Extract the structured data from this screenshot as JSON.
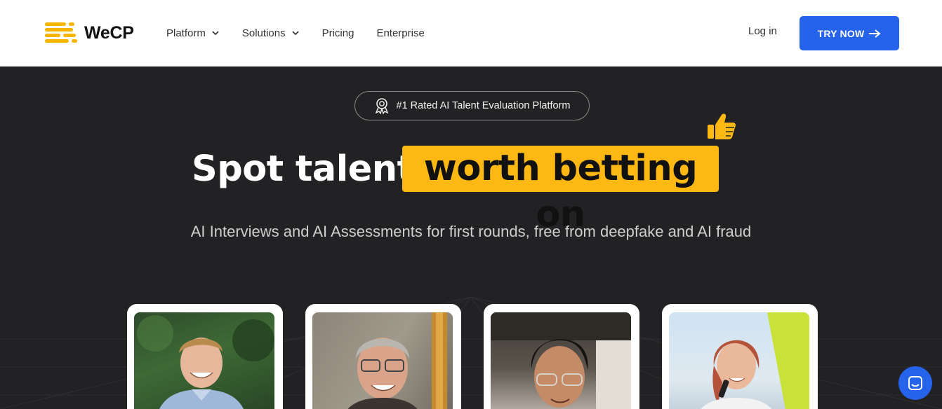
{
  "brand": {
    "name": "WeCP",
    "accent": "#fdb813",
    "primary": "#2563eb"
  },
  "nav": {
    "items": [
      {
        "label": "Platform",
        "has_dropdown": true
      },
      {
        "label": "Solutions",
        "has_dropdown": true
      },
      {
        "label": "Pricing",
        "has_dropdown": false
      },
      {
        "label": "Enterprise",
        "has_dropdown": false
      }
    ],
    "login_label": "Log in",
    "cta_label": "TRY NOW"
  },
  "hero": {
    "badge_text": "#1 Rated AI Talent Evaluation Platform",
    "headline_plain": "Spot talent",
    "headline_highlight": "worth betting on",
    "subtitle": "AI Interviews and AI Assessments for first rounds, free from deepfake and AI fraud"
  },
  "cards": [
    {
      "icon": "person-photo"
    },
    {
      "icon": "person-photo"
    },
    {
      "icon": "person-photo"
    },
    {
      "icon": "person-photo"
    }
  ],
  "chat": {
    "icon": "chat-icon"
  }
}
